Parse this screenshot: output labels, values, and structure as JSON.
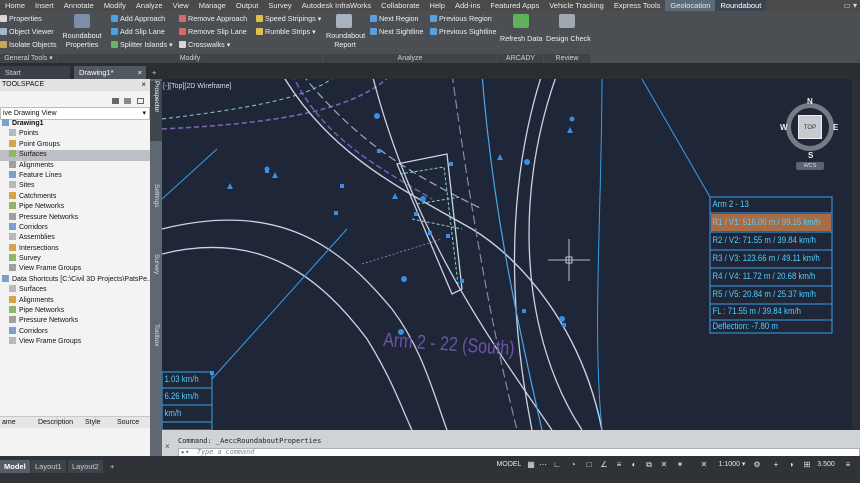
{
  "menu_tabs": [
    "Home",
    "Insert",
    "Annotate",
    "Modify",
    "Analyze",
    "View",
    "Manage",
    "Output",
    "Survey",
    "Autodesk InfraWorks",
    "Collaborate",
    "Help",
    "Add-ins",
    "Featured Apps",
    "Vehicle Tracking",
    "Express Tools",
    "Geolocation",
    "Roundabout"
  ],
  "window_controls": "▭ ▾",
  "ribbon": {
    "props_small": [
      "Properties",
      "Object Viewer",
      "Isolate Objects"
    ],
    "roundabout_properties": "Roundabout Properties",
    "add_approach": "Add Approach",
    "add_slip_lane": "Add Slip Lane",
    "splitter_islands": "Splitter Islands",
    "remove_approach": "Remove Approach",
    "remove_slip_lane": "Remove Slip Lane",
    "crosswalks": "Crosswalks",
    "speed_stripings": "Speed Stripings",
    "rumble_strips": "Rumble Strips",
    "roundabout_report": "Roundabout Report",
    "next_region": "Next Region",
    "next_sightline": "Next Sightline",
    "previous_region": "Previous Region",
    "previous_sightline": "Previous Sightline",
    "refresh_data": "Refresh Data",
    "design_check": "Design Check",
    "panels": {
      "general_tools": "General Tools ▾",
      "modify": "Modify",
      "analyze": "Analyze",
      "arcady": "ARCADY",
      "review": "Review"
    }
  },
  "file_tabs": {
    "start": "Start",
    "drawing": "Drawing1*",
    "close": "×",
    "add": "+"
  },
  "toolspace": {
    "title": "TOOLSPACE",
    "view": "ive Drawing View",
    "tree": [
      {
        "label": "Drawing1",
        "level": 0,
        "bold": true
      },
      {
        "label": "Points",
        "level": 1
      },
      {
        "label": "Point Groups",
        "level": 1
      },
      {
        "label": "Surfaces",
        "level": 1,
        "selected": true
      },
      {
        "label": "Alignments",
        "level": 1
      },
      {
        "label": "Feature Lines",
        "level": 1
      },
      {
        "label": "Sites",
        "level": 1
      },
      {
        "label": "Catchments",
        "level": 1
      },
      {
        "label": "Pipe Networks",
        "level": 1
      },
      {
        "label": "Pressure Networks",
        "level": 1
      },
      {
        "label": "Corridors",
        "level": 1
      },
      {
        "label": "Assemblies",
        "level": 1
      },
      {
        "label": "Intersections",
        "level": 1
      },
      {
        "label": "Survey",
        "level": 1
      },
      {
        "label": "View Frame Groups",
        "level": 1
      },
      {
        "label": "Data Shortcuts [C:\\Civil 3D Projects\\PatsPe...",
        "level": 0
      },
      {
        "label": "Surfaces",
        "level": 1
      },
      {
        "label": "Alignments",
        "level": 1
      },
      {
        "label": "Pipe Networks",
        "level": 1
      },
      {
        "label": "Pressure Networks",
        "level": 1
      },
      {
        "label": "Corridors",
        "level": 1
      },
      {
        "label": "View Frame Groups",
        "level": 1
      }
    ],
    "columns": [
      "ame",
      "Description",
      "Style",
      "Source"
    ],
    "side_tabs": [
      "Prospector",
      "Settings",
      "Survey",
      "Toolbox"
    ]
  },
  "viewport": {
    "label": "[-][Top][2D Wireframe]",
    "viewcube": {
      "top": "TOP",
      "n": "N",
      "s": "S",
      "e": "E",
      "w": "W",
      "wcs": "WCS"
    },
    "arm_label": "Arm 2 - 22 (South)",
    "left_table": [
      "1.03 km/h",
      "6.26 km/h",
      "km/h"
    ],
    "arm_table": {
      "title": "Arm 2 - 13",
      "rows": [
        "R1 / V1: 516.00 m / 99.15 km/h",
        "R2 / V2: 71.55 m / 39.84 km/h",
        "R3 / V3: 123.66 m / 49.11 km/h",
        "R4 / V4: 11.72 m / 20.68 km/h",
        "R5 / V5: 20.84 m / 25.37 km/h",
        "FL : 71.55 m / 39.84 km/h",
        "Deflection: -7.80 m"
      ],
      "highlight_color": "#c1794a"
    }
  },
  "command": {
    "history": "Command: _AeccRoundaboutProperties",
    "placeholder": "Type a command"
  },
  "status": {
    "layouts": [
      "Model",
      "Layout1",
      "Layout2"
    ],
    "add": "+",
    "model": "MODEL",
    "scale": "1:1000 ▾",
    "value": "3.500"
  },
  "colors": {
    "accent_blue": "#3da8ec",
    "arm_label_purple": "#6a54a8",
    "road_lines": "#c9d3e6"
  }
}
